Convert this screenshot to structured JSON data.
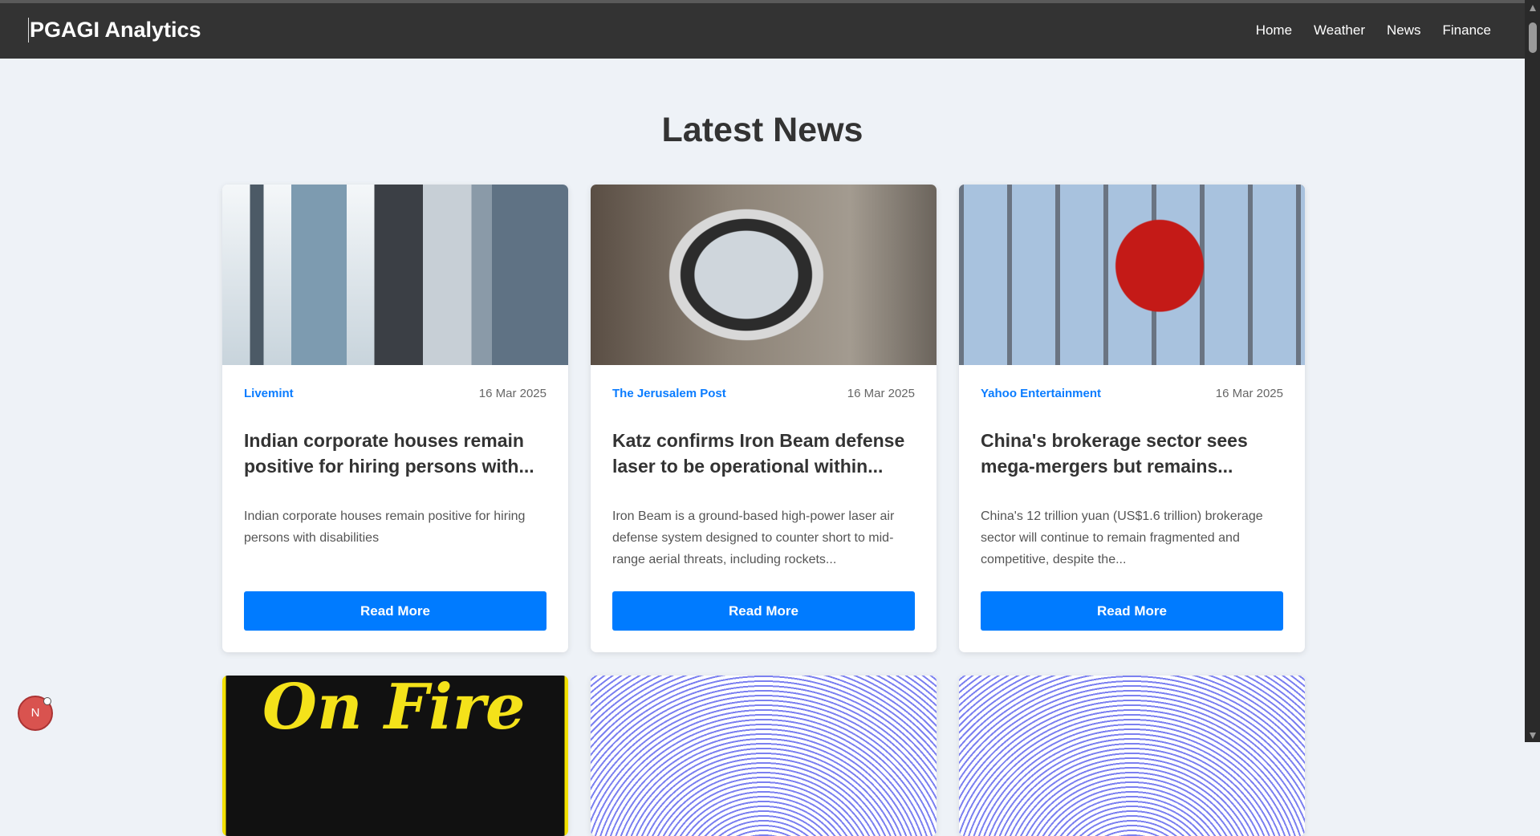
{
  "nav": {
    "brand": "PGAGI Analytics",
    "links": [
      "Home",
      "Weather",
      "News",
      "Finance"
    ]
  },
  "page": {
    "heading": "Latest News"
  },
  "articles": [
    {
      "source": "Livemint",
      "date": "16 Mar 2025",
      "title": "Indian corporate houses remain positive for hiring persons with...",
      "description": "Indian corporate houses remain positive for hiring persons with disabilities",
      "button": "Read More"
    },
    {
      "source": "The Jerusalem Post",
      "date": "16 Mar 2025",
      "title": "Katz confirms Iron Beam defense laser to be operational within...",
      "description": "Iron Beam is a ground-based high-power laser air defense system designed to counter short to mid-range aerial threats, including rockets...",
      "button": "Read More"
    },
    {
      "source": "Yahoo Entertainment",
      "date": "16 Mar 2025",
      "title": "China's brokerage sector sees mega-mergers but remains...",
      "description": "China's 12 trillion yuan (US$1.6 trillion) brokerage sector will continue to remain fragmented and competitive, despite the...",
      "button": "Read More"
    }
  ],
  "second_row": {
    "image_text": "On Fire"
  },
  "dev_badge": {
    "label": "N"
  },
  "colors": {
    "navbar": "#333333",
    "accent": "#007bff",
    "background": "#eef2f7"
  }
}
